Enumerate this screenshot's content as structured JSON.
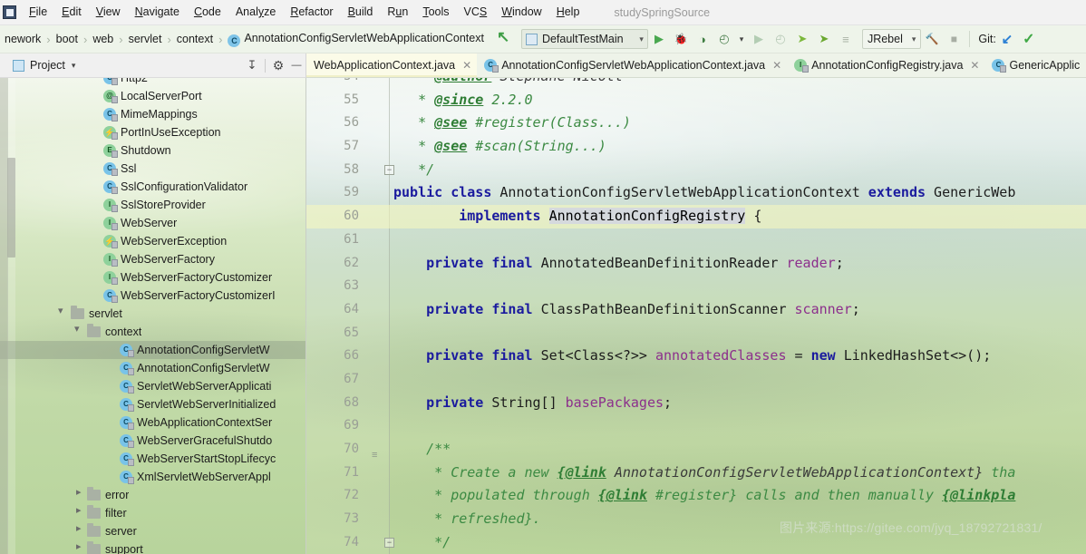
{
  "window": {
    "project_name": "studySpringSource",
    "app_icon": "intellij-idea-icon"
  },
  "menubar": {
    "items": [
      {
        "label": "File",
        "mnemonic_index": 0
      },
      {
        "label": "Edit",
        "mnemonic_index": 0
      },
      {
        "label": "View",
        "mnemonic_index": 0
      },
      {
        "label": "Navigate",
        "mnemonic_index": 0
      },
      {
        "label": "Code",
        "mnemonic_index": 0
      },
      {
        "label": "Analyze",
        "mnemonic_index": 4
      },
      {
        "label": "Refactor",
        "mnemonic_index": 0
      },
      {
        "label": "Build",
        "mnemonic_index": 0
      },
      {
        "label": "Run",
        "mnemonic_index": 1
      },
      {
        "label": "Tools",
        "mnemonic_index": 0
      },
      {
        "label": "VCS",
        "mnemonic_index": 2
      },
      {
        "label": "Window",
        "mnemonic_index": 0
      },
      {
        "label": "Help",
        "mnemonic_index": 0
      }
    ]
  },
  "navbar": {
    "breadcrumbs": [
      {
        "label": "nework",
        "icon": "none"
      },
      {
        "label": "boot",
        "icon": "none"
      },
      {
        "label": "web",
        "icon": "none"
      },
      {
        "label": "servlet",
        "icon": "none"
      },
      {
        "label": "context",
        "icon": "none"
      },
      {
        "label": "AnnotationConfigServletWebApplicationContext",
        "icon": "class-icon"
      }
    ],
    "separator": "›"
  },
  "toolbar": {
    "up_arrow_icon": "navigate-up-icon",
    "run_config": {
      "icon": "run-configuration-icon",
      "label": "DefaultTestMain",
      "caret": "▾"
    },
    "buttons": [
      {
        "name": "run-button",
        "icon": "play-icon",
        "enabled": true
      },
      {
        "name": "debug-button",
        "icon": "bug-icon",
        "enabled": true
      },
      {
        "name": "run-with-coverage-button",
        "icon": "coverage-icon",
        "enabled": true
      },
      {
        "name": "profile-button",
        "icon": "profiler-icon",
        "enabled": true
      },
      {
        "name": "profile-dropdown",
        "icon": "chevron-down-icon",
        "enabled": true
      },
      {
        "name": "rerun-button",
        "icon": "play-icon",
        "enabled": false
      },
      {
        "name": "attach-profiler-button",
        "icon": "profiler-icon",
        "enabled": false
      },
      {
        "name": "jrebel-run-button",
        "icon": "jrebel-run-icon",
        "enabled": true
      },
      {
        "name": "jrebel-debug-button",
        "icon": "jrebel-debug-icon",
        "enabled": true
      },
      {
        "name": "run-dashboard-button",
        "icon": "lines-icon",
        "enabled": false
      }
    ],
    "jrebel_select": {
      "label": "JRebel",
      "caret": "▾"
    },
    "build_button": {
      "icon": "hammer-icon",
      "enabled": false
    },
    "stop_button": {
      "icon": "stop-icon",
      "enabled": false
    },
    "git": {
      "label": "Git:",
      "update_icon": "vcs-update-icon",
      "commit_icon": "vcs-commit-check-icon"
    }
  },
  "project_panel": {
    "title": "Project",
    "caret": "▾",
    "header_buttons": [
      {
        "name": "collapse-all-button",
        "icon": "collapse-all-icon"
      },
      {
        "name": "settings-button",
        "icon": "gear-icon"
      },
      {
        "name": "hide-button",
        "icon": "minimize-icon"
      }
    ],
    "tree": [
      {
        "label": "Http2",
        "icon": "class-icon",
        "indent": 5,
        "twisty": "none",
        "partial": true
      },
      {
        "label": "LocalServerPort",
        "icon": "annotation-icon",
        "indent": 5,
        "twisty": "none"
      },
      {
        "label": "MimeMappings",
        "icon": "class-icon",
        "indent": 5,
        "twisty": "none"
      },
      {
        "label": "PortInUseException",
        "icon": "exception-icon",
        "indent": 5,
        "twisty": "none"
      },
      {
        "label": "Shutdown",
        "icon": "enum-icon",
        "indent": 5,
        "twisty": "none"
      },
      {
        "label": "Ssl",
        "icon": "class-icon",
        "indent": 5,
        "twisty": "none"
      },
      {
        "label": "SslConfigurationValidator",
        "icon": "class-icon",
        "indent": 5,
        "twisty": "none"
      },
      {
        "label": "SslStoreProvider",
        "icon": "interface-icon",
        "indent": 5,
        "twisty": "none"
      },
      {
        "label": "WebServer",
        "icon": "interface-icon",
        "indent": 5,
        "twisty": "none"
      },
      {
        "label": "WebServerException",
        "icon": "exception-icon",
        "indent": 5,
        "twisty": "none"
      },
      {
        "label": "WebServerFactory",
        "icon": "interface-icon",
        "indent": 5,
        "twisty": "none"
      },
      {
        "label": "WebServerFactoryCustomizer",
        "icon": "interface-icon",
        "indent": 5,
        "twisty": "none"
      },
      {
        "label": "WebServerFactoryCustomizerI",
        "icon": "class-icon",
        "indent": 5,
        "twisty": "none",
        "clipped": true
      },
      {
        "label": "servlet",
        "icon": "folder-icon",
        "indent": 3,
        "twisty": "down"
      },
      {
        "label": "context",
        "icon": "folder-icon",
        "indent": 4,
        "twisty": "down"
      },
      {
        "label": "AnnotationConfigServletW",
        "icon": "class-icon",
        "indent": 6,
        "twisty": "none",
        "selected": true,
        "clipped": true
      },
      {
        "label": "AnnotationConfigServletW",
        "icon": "class-icon",
        "indent": 6,
        "twisty": "none",
        "clipped": true
      },
      {
        "label": "ServletWebServerApplicati",
        "icon": "class-icon",
        "indent": 6,
        "twisty": "none",
        "clipped": true
      },
      {
        "label": "ServletWebServerInitialized",
        "icon": "class-icon",
        "indent": 6,
        "twisty": "none",
        "clipped": true
      },
      {
        "label": "WebApplicationContextSer",
        "icon": "class-icon",
        "indent": 6,
        "twisty": "none",
        "clipped": true
      },
      {
        "label": "WebServerGracefulShutdo",
        "icon": "class-icon",
        "indent": 6,
        "twisty": "none",
        "clipped": true
      },
      {
        "label": "WebServerStartStopLifecyc",
        "icon": "class-icon",
        "indent": 6,
        "twisty": "none",
        "clipped": true
      },
      {
        "label": "XmlServletWebServerAppl",
        "icon": "class-icon",
        "indent": 6,
        "twisty": "none",
        "clipped": true
      },
      {
        "label": "error",
        "icon": "folder-icon",
        "indent": 4,
        "twisty": "right"
      },
      {
        "label": "filter",
        "icon": "folder-icon",
        "indent": 4,
        "twisty": "right"
      },
      {
        "label": "server",
        "icon": "folder-icon",
        "indent": 4,
        "twisty": "right"
      },
      {
        "label": "support",
        "icon": "folder-icon",
        "indent": 4,
        "twisty": "right"
      }
    ]
  },
  "editor_tabs": [
    {
      "label": "WebApplicationContext.java",
      "icon": "class-icon",
      "active": true,
      "clipped_left": true,
      "closeable": true
    },
    {
      "label": "AnnotationConfigServletWebApplicationContext.java",
      "icon": "class-icon",
      "active": false,
      "closeable": true
    },
    {
      "label": "AnnotationConfigRegistry.java",
      "icon": "interface-icon",
      "active": false,
      "closeable": true
    },
    {
      "label": "GenericApplic",
      "icon": "class-icon",
      "active": false,
      "closeable": false,
      "clipped": true
    }
  ],
  "editor": {
    "highlighted_line": 60,
    "lines": [
      {
        "num": 54,
        "tokens": [
          {
            "t": "   * ",
            "c": "cmt"
          },
          {
            "t": "@author",
            "c": "cmtb"
          },
          {
            "t": " Stephane Nicoll",
            "c": "cmtt"
          }
        ],
        "partial_top": true
      },
      {
        "num": 55,
        "tokens": [
          {
            "t": "   * ",
            "c": "cmt"
          },
          {
            "t": "@since",
            "c": "cmtb"
          },
          {
            "t": " 2.2.0",
            "c": "cmt"
          }
        ]
      },
      {
        "num": 56,
        "tokens": [
          {
            "t": "   * ",
            "c": "cmt"
          },
          {
            "t": "@see",
            "c": "cmtb"
          },
          {
            "t": " #register(Class...)",
            "c": "cmt"
          }
        ]
      },
      {
        "num": 57,
        "tokens": [
          {
            "t": "   * ",
            "c": "cmt"
          },
          {
            "t": "@see",
            "c": "cmtb"
          },
          {
            "t": " #scan(String...)",
            "c": "cmt"
          }
        ]
      },
      {
        "num": 58,
        "tokens": [
          {
            "t": "   */",
            "c": "cmt"
          }
        ],
        "fold": true
      },
      {
        "num": 59,
        "tokens": [
          {
            "t": "public ",
            "c": "kw"
          },
          {
            "t": "class ",
            "c": "kw"
          },
          {
            "t": "AnnotationConfigServletWebApplicationContext ",
            "c": "typ"
          },
          {
            "t": "extends ",
            "c": "kw"
          },
          {
            "t": "GenericWeb",
            "c": "typ"
          }
        ]
      },
      {
        "num": 60,
        "tokens": [
          {
            "t": "        ",
            "c": "typ"
          },
          {
            "t": "implements ",
            "c": "kw"
          },
          {
            "t": "AnnotationConfigRegistry",
            "c": "hlword"
          },
          {
            "t": " {",
            "c": "typ"
          }
        ],
        "highlight": true
      },
      {
        "num": 61,
        "tokens": []
      },
      {
        "num": 62,
        "tokens": [
          {
            "t": "    ",
            "c": "typ"
          },
          {
            "t": "private final ",
            "c": "kw"
          },
          {
            "t": "AnnotatedBeanDefinitionReader ",
            "c": "typ"
          },
          {
            "t": "reader",
            "c": "fld"
          },
          {
            "t": ";",
            "c": "typ"
          }
        ]
      },
      {
        "num": 63,
        "tokens": []
      },
      {
        "num": 64,
        "tokens": [
          {
            "t": "    ",
            "c": "typ"
          },
          {
            "t": "private final ",
            "c": "kw"
          },
          {
            "t": "ClassPathBeanDefinitionScanner ",
            "c": "typ"
          },
          {
            "t": "scanner",
            "c": "fld"
          },
          {
            "t": ";",
            "c": "typ"
          }
        ]
      },
      {
        "num": 65,
        "tokens": []
      },
      {
        "num": 66,
        "tokens": [
          {
            "t": "    ",
            "c": "typ"
          },
          {
            "t": "private final ",
            "c": "kw"
          },
          {
            "t": "Set<Class<?>> ",
            "c": "typ"
          },
          {
            "t": "annotatedClasses",
            "c": "fld"
          },
          {
            "t": " = ",
            "c": "typ"
          },
          {
            "t": "new ",
            "c": "kw"
          },
          {
            "t": "LinkedHashSet<>();",
            "c": "typ"
          }
        ]
      },
      {
        "num": 67,
        "tokens": []
      },
      {
        "num": 68,
        "tokens": [
          {
            "t": "    ",
            "c": "typ"
          },
          {
            "t": "private ",
            "c": "kw"
          },
          {
            "t": "String[] ",
            "c": "typ"
          },
          {
            "t": "basePackages",
            "c": "fld"
          },
          {
            "t": ";",
            "c": "typ"
          }
        ]
      },
      {
        "num": 69,
        "tokens": []
      },
      {
        "num": 70,
        "tokens": [
          {
            "t": "    /**",
            "c": "cmt"
          }
        ],
        "gutter_icon": "method-separator-icon"
      },
      {
        "num": 71,
        "tokens": [
          {
            "t": "     * Create a new ",
            "c": "cmt"
          },
          {
            "t": "{@link",
            "c": "cmtb"
          },
          {
            "t": " AnnotationConfigServletWebApplicationContext}",
            "c": "cmtt"
          },
          {
            "t": " tha",
            "c": "cmt"
          }
        ]
      },
      {
        "num": 72,
        "tokens": [
          {
            "t": "     * populated through ",
            "c": "cmt"
          },
          {
            "t": "{@link",
            "c": "cmtb"
          },
          {
            "t": " #register}",
            "c": "cmt"
          },
          {
            "t": " calls and then manually ",
            "c": "cmt"
          },
          {
            "t": "{@linkpla",
            "c": "cmtb"
          }
        ]
      },
      {
        "num": 73,
        "tokens": [
          {
            "t": "     * refreshed}.",
            "c": "cmt"
          }
        ]
      },
      {
        "num": 74,
        "tokens": [
          {
            "t": "     */",
            "c": "cmt"
          }
        ],
        "fold": true,
        "partial_bottom": true
      }
    ]
  },
  "watermark": {
    "text": "图片来源:https://gitee.com/jyq_18792721831/"
  }
}
